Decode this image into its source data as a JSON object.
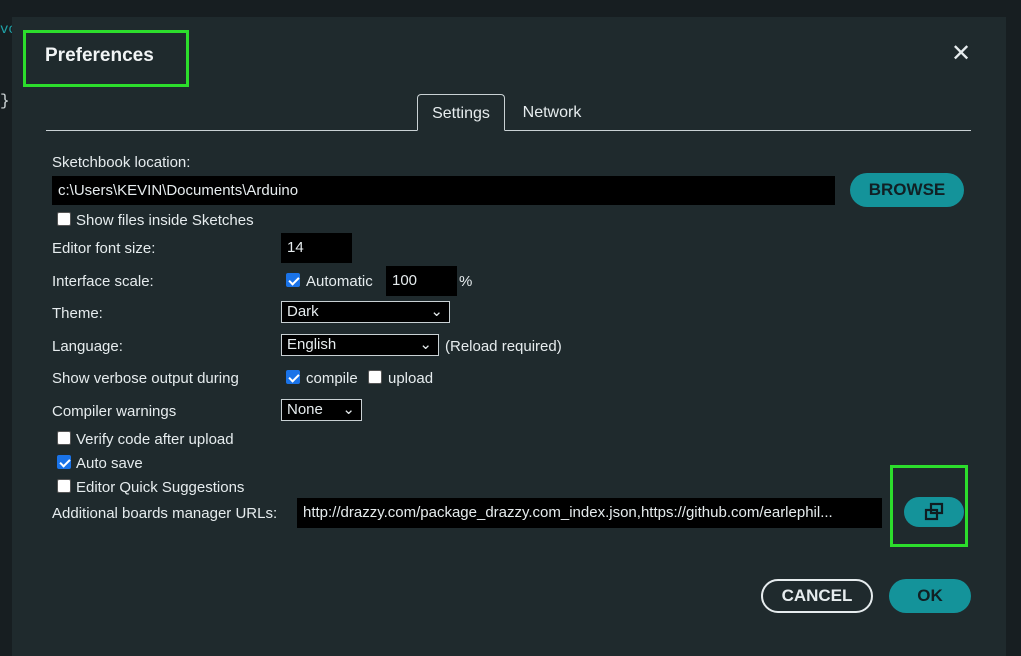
{
  "background": {
    "fragment_text": "vo",
    "brace": "}"
  },
  "dialog": {
    "title": "Preferences",
    "close_glyph": "✕"
  },
  "tabs": [
    {
      "label": "Settings",
      "active": true
    },
    {
      "label": "Network",
      "active": false
    }
  ],
  "sketchbook": {
    "label": "Sketchbook location:",
    "path": "c:\\Users\\KEVIN\\Documents\\Arduino",
    "browse_label": "BROWSE"
  },
  "show_files": {
    "label": "Show files inside Sketches",
    "checked": false
  },
  "font_size": {
    "label": "Editor font size:",
    "value": "14"
  },
  "interface_scale": {
    "label": "Interface scale:",
    "automatic_label": "Automatic",
    "automatic_checked": true,
    "value": "100",
    "unit": "%"
  },
  "theme": {
    "label": "Theme:",
    "selected": "Dark"
  },
  "language": {
    "label": "Language:",
    "selected": "English",
    "note": "(Reload required)"
  },
  "verbose": {
    "label": "Show verbose output during",
    "compile_label": "compile",
    "compile_checked": true,
    "upload_label": "upload",
    "upload_checked": false
  },
  "compiler_warnings": {
    "label": "Compiler warnings",
    "selected": "None"
  },
  "verify_upload": {
    "label": "Verify code after upload",
    "checked": false
  },
  "auto_save": {
    "label": "Auto save",
    "checked": true
  },
  "quick_suggestions": {
    "label": "Editor Quick Suggestions",
    "checked": false
  },
  "boards_urls": {
    "label": "Additional boards manager URLs:",
    "value": "http://drazzy.com/package_drazzy.com_index.json,https://github.com/earlephil...",
    "edit_icon": "open-window-icon"
  },
  "footer": {
    "cancel_label": "CANCEL",
    "ok_label": "OK"
  },
  "colors": {
    "accent": "#14939a",
    "highlight": "#2cdd2c",
    "dialog_bg": "#1f2a2d",
    "input_bg": "#000000"
  }
}
